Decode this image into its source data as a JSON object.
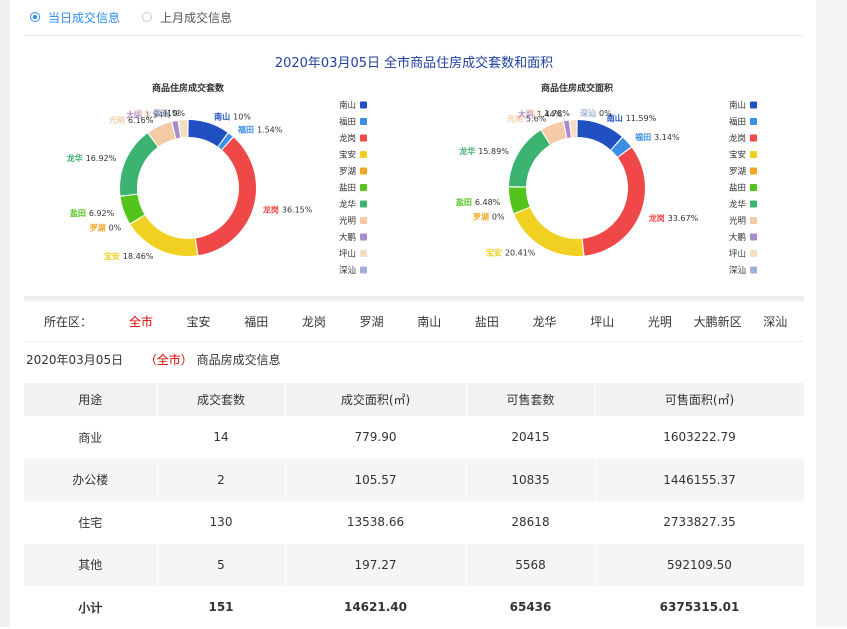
{
  "tabs": [
    {
      "label": "当日成交信息",
      "active": true
    },
    {
      "label": "上月成交信息",
      "active": false
    }
  ],
  "chart_title": "2020年03月05日 全市商品住房成交套数和面积",
  "chart_data": [
    {
      "type": "pie",
      "title": "商品住房成交套数",
      "categories": [
        "南山",
        "福田",
        "龙岗",
        "宝安",
        "罗湖",
        "盐田",
        "龙华",
        "光明",
        "大鹏",
        "坪山",
        "深汕"
      ],
      "values": [
        10,
        1.54,
        36.15,
        18.46,
        0,
        6.92,
        16.92,
        6.16,
        1.54,
        2.31,
        0
      ],
      "labels": [
        "10%",
        "1.54%",
        "36.15%",
        "18.46%",
        "0%",
        "6.92%",
        "16.92%",
        "6.16%",
        "1.54%",
        "2.31%",
        "0%"
      ],
      "legend_position": "right"
    },
    {
      "type": "pie",
      "title": "商品住房成交面积",
      "categories": [
        "南山",
        "福田",
        "龙岗",
        "宝安",
        "罗湖",
        "盐田",
        "龙华",
        "光明",
        "大鹏",
        "坪山",
        "深汕"
      ],
      "values": [
        11.59,
        3.14,
        33.67,
        20.41,
        0,
        6.48,
        15.89,
        5.6,
        1.44,
        1.78,
        0
      ],
      "labels": [
        "11.59%",
        "3.14%",
        "33.67%",
        "20.41%",
        "0%",
        "6.48%",
        "15.89%",
        "5.6%",
        "1.44%",
        "1.78%",
        "0%"
      ],
      "legend_position": "right"
    }
  ],
  "colors": {
    "南山": "#1f4fc1",
    "福田": "#3a8ee6",
    "龙岗": "#f04848",
    "宝安": "#f0d020",
    "罗湖": "#f5a623",
    "盐田": "#52c41a",
    "龙华": "#3cb371",
    "光明": "#f5cba7",
    "大鹏": "#a88bc9",
    "坪山": "#f7ddc4",
    "深汕": "#9fb1d9",
    "accent": "#2d8cf0",
    "highlight": "#e60000"
  },
  "district_filter": {
    "label": "所在区：",
    "items": [
      "全市",
      "宝安",
      "福田",
      "龙岗",
      "罗湖",
      "南山",
      "盐田",
      "龙华",
      "坪山",
      "光明",
      "大鹏新区",
      "深汕"
    ],
    "active_index": 0
  },
  "info": {
    "date": "2020年03月05日",
    "region": "（全市）",
    "suffix": "商品房成交信息"
  },
  "table": {
    "headers": [
      "用途",
      "成交套数",
      "成交面积(㎡)",
      "可售套数",
      "可售面积(㎡)"
    ],
    "rows": [
      [
        "商业",
        "14",
        "779.90",
        "20415",
        "1603222.79"
      ],
      [
        "办公楼",
        "2",
        "105.57",
        "10835",
        "1446155.37"
      ],
      [
        "住宅",
        "130",
        "13538.66",
        "28618",
        "2733827.35"
      ],
      [
        "其他",
        "5",
        "197.27",
        "5568",
        "592109.50"
      ],
      [
        "小计",
        "151",
        "14621.40",
        "65436",
        "6375315.01"
      ]
    ]
  }
}
